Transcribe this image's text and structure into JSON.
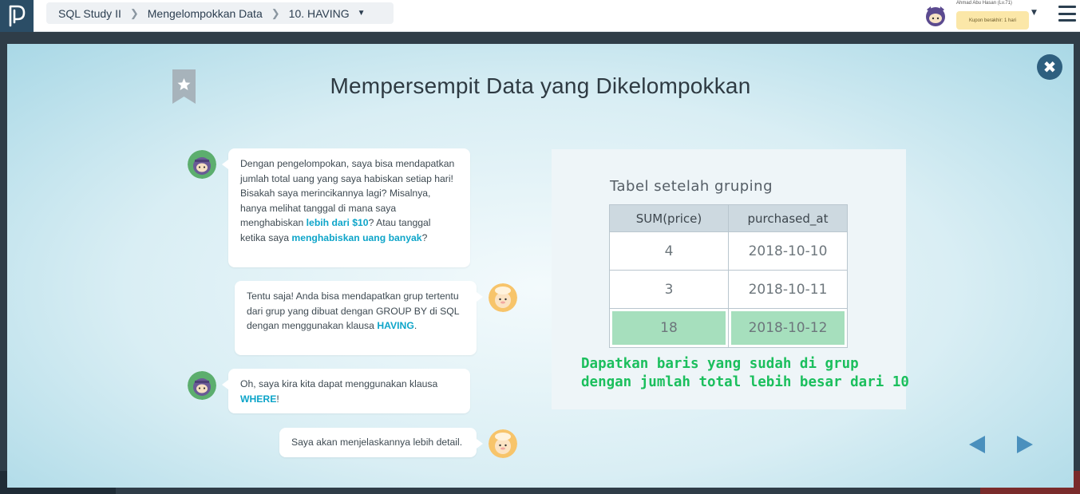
{
  "header": {
    "breadcrumb": [
      "SQL Study II",
      "Mengelompokkan Data",
      "10. HAVING"
    ],
    "user_name": "Ahmad Abu Hasan (Lv.71)",
    "coupon": "Kupon berakhir: 1 hari",
    "colors": {
      "logo_bg": "#2b4d66",
      "coupon_bg": "#fbe7a8"
    }
  },
  "slide": {
    "title": "Mempersempit Data yang Dikelompokkan",
    "chat": [
      {
        "speaker": "ninja",
        "side": "left",
        "parts": [
          {
            "text": "Dengan pengelompokan, saya bisa mendapatkan jumlah total uang yang saya habiskan setiap hari! Bisakah saya merincikannya lagi? Misalnya, hanya melihat tanggal di mana saya menghabiskan "
          },
          {
            "text": "lebih dari $10",
            "hl": true
          },
          {
            "text": "? Atau tanggal ketika saya "
          },
          {
            "text": "menghabiskan uang banyak",
            "hl": true
          },
          {
            "text": "?"
          }
        ]
      },
      {
        "speaker": "sheep",
        "side": "right",
        "parts": [
          {
            "text": "Tentu saja! Anda bisa mendapatkan grup tertentu dari grup yang dibuat dengan GROUP BY di SQL dengan menggunakan klausa "
          },
          {
            "text": "HAVING",
            "hl": true
          },
          {
            "text": "."
          }
        ]
      },
      {
        "speaker": "ninja",
        "side": "left",
        "parts": [
          {
            "text": "Oh, saya kira kita dapat menggunakan klausa "
          },
          {
            "text": "WHERE",
            "hl": true
          },
          {
            "text": "!"
          }
        ]
      },
      {
        "speaker": "sheep",
        "side": "right",
        "parts": [
          {
            "text": "Saya akan menjelaskannya lebih detail."
          }
        ]
      }
    ],
    "panel": {
      "caption": "Tabel setelah gruping",
      "columns": [
        "SUM(price)",
        "purchased_at"
      ],
      "rows": [
        [
          "4",
          "2018-10-10"
        ],
        [
          "3",
          "2018-10-11"
        ],
        [
          "18",
          "2018-10-12"
        ]
      ],
      "highlight_color": "#a6dfbd",
      "note_line1": "Dapatkan baris yang sudah di grup",
      "note_line2": "dengan jumlah total lebih besar dari 10",
      "note_color": "#1bbf5d"
    },
    "close_icon": "close-icon",
    "nav": {
      "prev_icon": "arrow-left-icon",
      "next_icon": "arrow-right-icon"
    },
    "accent_color": "#0ea5c9"
  }
}
